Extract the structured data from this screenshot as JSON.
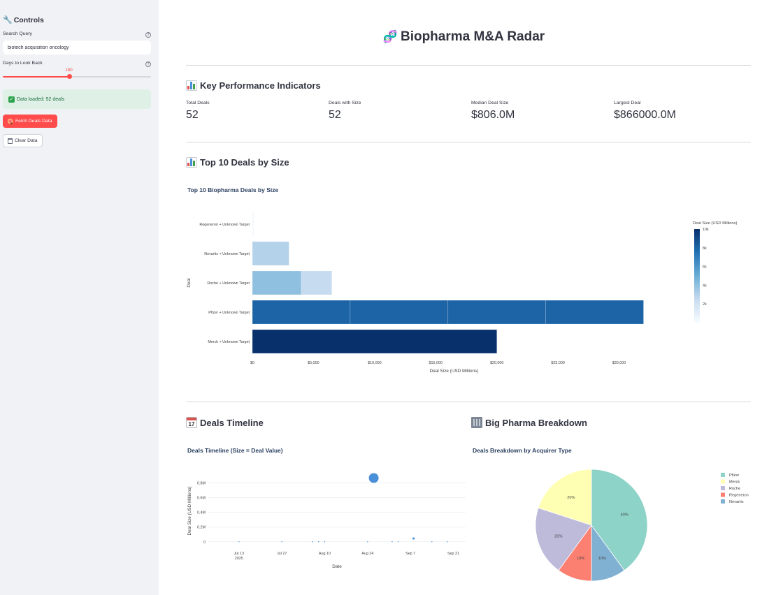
{
  "sidebar": {
    "title": "Controls",
    "search": {
      "label": "Search Query",
      "value": "biotech acquisition oncology"
    },
    "days": {
      "label": "Days to Look Back",
      "value": 180,
      "fill": 0.45
    },
    "alert": "Data loaded: 52 deals",
    "fetch_button": "Fetch Deals Data",
    "clear_button": "Clear Data",
    "help_glyph": "?"
  },
  "header": {
    "title": "Biopharma M&A Radar"
  },
  "kpi_section": {
    "title": "Key Performance Indicators",
    "items": [
      {
        "label": "Total Deals",
        "value": "52"
      },
      {
        "label": "Deals with Size",
        "value": "52"
      },
      {
        "label": "Median Deal Size",
        "value": "$806.0M"
      },
      {
        "label": "Largest Deal",
        "value": "$866000.0M"
      }
    ]
  },
  "top10_section": {
    "title": "Top 10 Deals by Size"
  },
  "timeline_section": {
    "title": "Deals Timeline",
    "calendar_day": "17"
  },
  "pharma_section": {
    "title": "Big Pharma Breakdown"
  },
  "chart_data": [
    {
      "type": "bar",
      "orientation": "horizontal",
      "title": "Top 10 Biopharma Deals by Size",
      "xlabel": "Deal Size (USD Millions)",
      "ylabel": "Deal",
      "xlim": [
        0,
        33000
      ],
      "x_ticks": [
        0,
        5000,
        10000,
        15000,
        20000,
        25000,
        30000
      ],
      "x_tick_labels": [
        "$0",
        "$5,000",
        "$10,000",
        "$15,000",
        "$20,000",
        "$25,000",
        "$30,000"
      ],
      "categories": [
        "Regeneron + Unknown Target",
        "Novartis + Unknown Target",
        "Roche + Unknown Target",
        "Pfizer + Unknown Target",
        "Merck + Unknown Target"
      ],
      "stacked_segments": [
        [
          150
        ],
        [
          3000
        ],
        [
          4000,
          2500
        ],
        [
          8000,
          8000,
          8000,
          8000
        ],
        [
          20000
        ]
      ],
      "colorbar": {
        "title": "Deal Size (USD Millions)",
        "ticks": [
          "2k",
          "4k",
          "6k",
          "8k",
          "10k"
        ],
        "range": [
          0,
          10000
        ]
      }
    },
    {
      "type": "scatter",
      "title": "Deals Timeline (Size = Deal Value)",
      "xlabel": "Date",
      "ylabel": "Deal Size (USD Millions)",
      "x_ticks": [
        "2025-07-13",
        "2025-07-27",
        "2025-08-10",
        "2025-08-24",
        "2025-09-07",
        "2025-09-21"
      ],
      "x_tick_labels": [
        "Jul 13",
        "Jul 27",
        "Aug 10",
        "Aug 24",
        "Sep 7",
        "Sep 21"
      ],
      "x_tick_sublabel": "2025",
      "x_range": [
        "2025-07-03",
        "2025-09-25"
      ],
      "y_ticks": [
        0,
        200000,
        400000,
        600000,
        800000
      ],
      "y_tick_labels": [
        "0",
        "0.2M",
        "0.4M",
        "0.6M",
        "0.8M"
      ],
      "ylim": [
        -40000,
        880000
      ],
      "points": [
        {
          "x": "2025-07-13",
          "y": 200
        },
        {
          "x": "2025-07-27",
          "y": 800
        },
        {
          "x": "2025-08-06",
          "y": 400
        },
        {
          "x": "2025-08-08",
          "y": 600
        },
        {
          "x": "2025-08-10",
          "y": 300
        },
        {
          "x": "2025-08-24",
          "y": 100
        },
        {
          "x": "2025-08-26",
          "y": 866000
        },
        {
          "x": "2025-09-01",
          "y": 1500
        },
        {
          "x": "2025-09-03",
          "y": 700
        },
        {
          "x": "2025-09-08",
          "y": 45000
        },
        {
          "x": "2025-09-14",
          "y": 500
        },
        {
          "x": "2025-09-19",
          "y": 300
        }
      ],
      "marker_color": "#4a90d9"
    },
    {
      "type": "pie",
      "title": "Deals Breakdown by Acquirer Type",
      "labels": [
        "Pfizer",
        "Merck",
        "Roche",
        "Regeneron",
        "Novartis"
      ],
      "values": [
        40,
        20,
        20,
        10,
        10
      ],
      "slice_labels": [
        "40%",
        "20%",
        "20%",
        "10%",
        "10%"
      ],
      "colors": [
        "#8dd3c7",
        "#ffffb3",
        "#bebada",
        "#fb8072",
        "#80b1d3"
      ],
      "drawing_order": [
        "Pfizer",
        "Novartis",
        "Regeneron",
        "Roche",
        "Merck"
      ]
    }
  ]
}
